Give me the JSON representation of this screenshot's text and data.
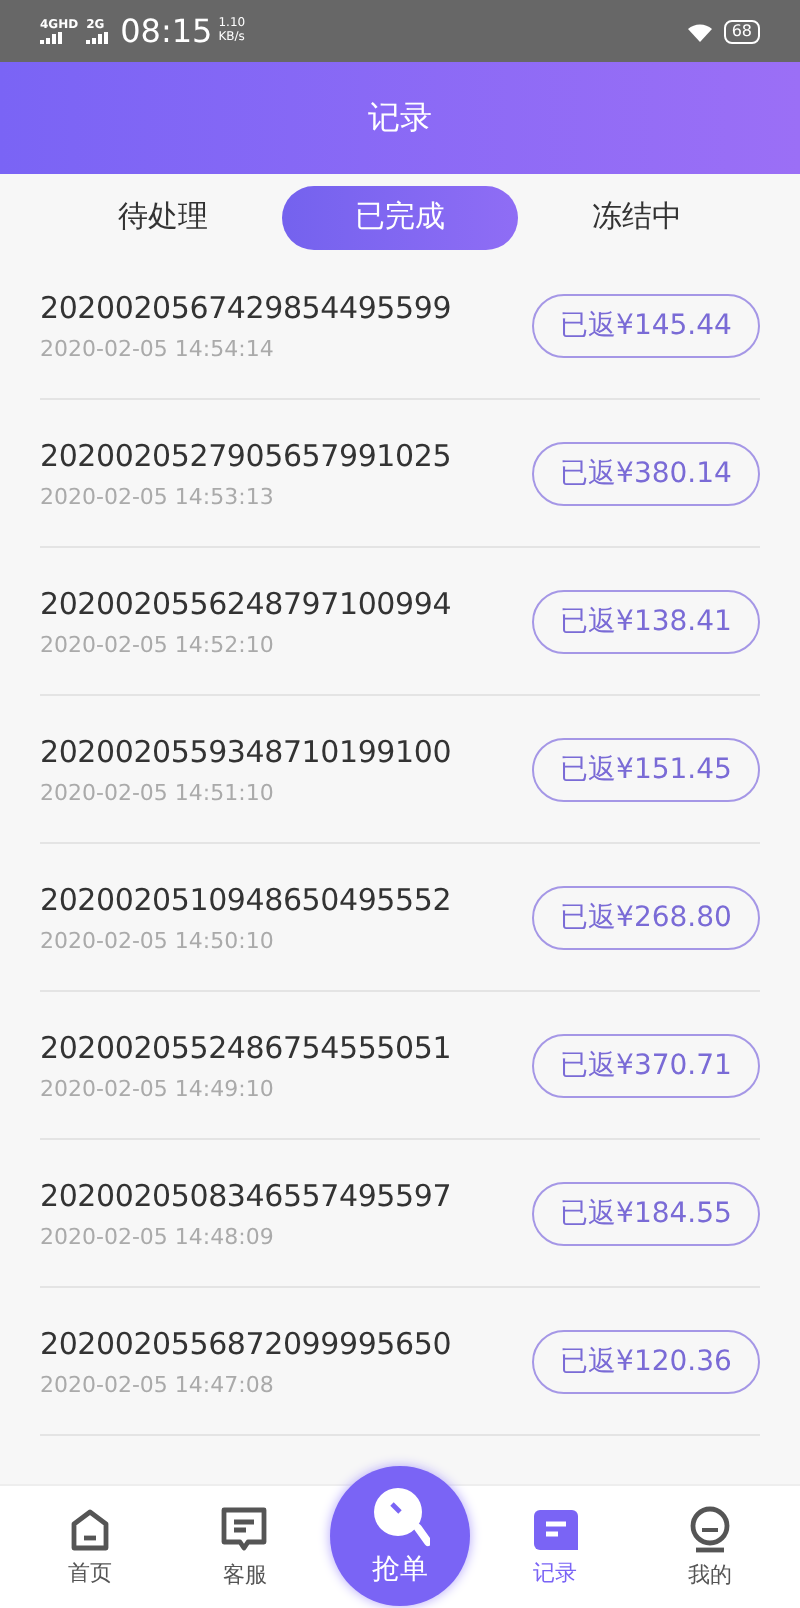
{
  "status_bar": {
    "network_1": "4GHD",
    "network_2": "2G",
    "time": "08:15",
    "speed_value": "1.10",
    "speed_unit": "KB/s",
    "battery": "68"
  },
  "header": {
    "title": "记录"
  },
  "tabs": [
    {
      "label": "待处理",
      "selected": false
    },
    {
      "label": "已完成",
      "selected": true
    },
    {
      "label": "冻结中",
      "selected": false
    }
  ],
  "records": [
    {
      "order_no": "2020020567429854495599",
      "time": "2020-02-05 14:54:14",
      "amount": "已返¥145.44"
    },
    {
      "order_no": "2020020527905657991025",
      "time": "2020-02-05 14:53:13",
      "amount": "已返¥380.14"
    },
    {
      "order_no": "2020020556248797100994",
      "time": "2020-02-05 14:52:10",
      "amount": "已返¥138.41"
    },
    {
      "order_no": "2020020559348710199100",
      "time": "2020-02-05 14:51:10",
      "amount": "已返¥151.45"
    },
    {
      "order_no": "2020020510948650495552",
      "time": "2020-02-05 14:50:10",
      "amount": "已返¥268.80"
    },
    {
      "order_no": "2020020552486754555051",
      "time": "2020-02-05 14:49:10",
      "amount": "已返¥370.71"
    },
    {
      "order_no": "2020020508346557495597",
      "time": "2020-02-05 14:48:09",
      "amount": "已返¥184.55"
    },
    {
      "order_no": "2020020556872099995650",
      "time": "2020-02-05 14:47:08",
      "amount": "已返¥120.36"
    }
  ],
  "bottom_nav": [
    {
      "label": "首页",
      "kind": "home",
      "selected": false
    },
    {
      "label": "客服",
      "kind": "service",
      "selected": false
    },
    {
      "label": "抢单",
      "kind": "center",
      "selected": false
    },
    {
      "label": "记录",
      "kind": "records",
      "selected": true
    },
    {
      "label": "我的",
      "kind": "profile",
      "selected": false
    }
  ]
}
